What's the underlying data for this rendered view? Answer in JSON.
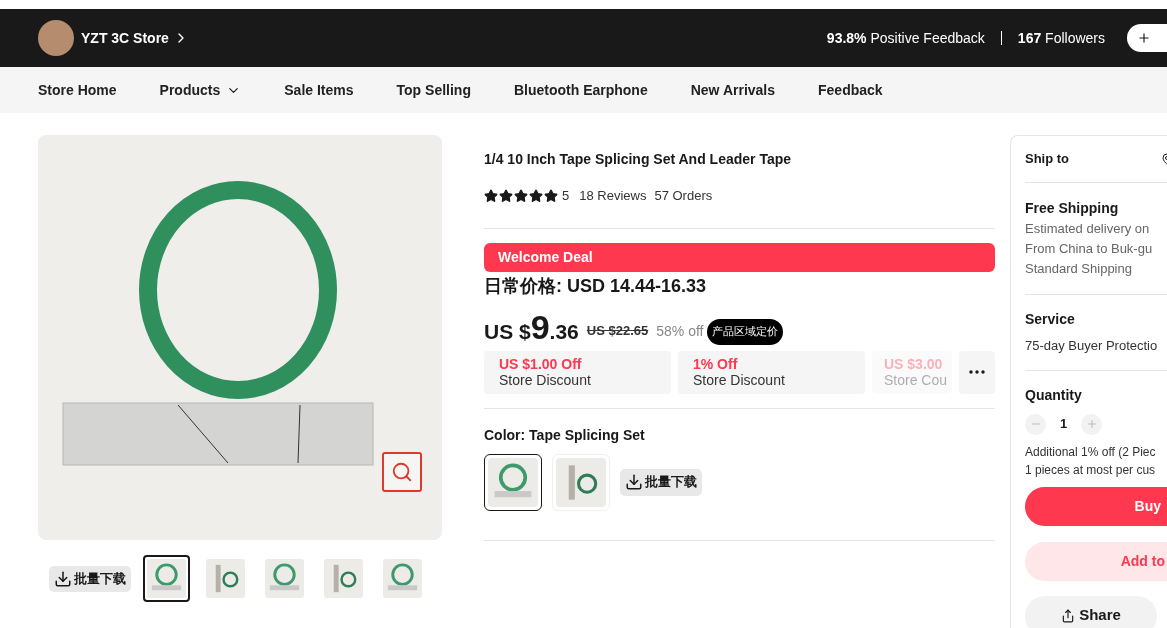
{
  "store_bar": {
    "name": "YZT 3C Store",
    "feedback_value": "93.8%",
    "feedback_label": "Positive Feedback",
    "followers_value": "167",
    "followers_label": "Followers"
  },
  "nav": [
    {
      "label": "Store Home",
      "dropdown": false
    },
    {
      "label": "Products",
      "dropdown": true
    },
    {
      "label": "Sale Items",
      "dropdown": false
    },
    {
      "label": "Top Selling",
      "dropdown": false
    },
    {
      "label": "Bluetooth Earphone",
      "dropdown": false
    },
    {
      "label": "New Arrivals",
      "dropdown": false
    },
    {
      "label": "Feedback",
      "dropdown": false
    }
  ],
  "gallery": {
    "download_label": "批量下载",
    "thumbnails": [
      {
        "selected": true
      },
      {
        "selected": false
      },
      {
        "selected": false
      },
      {
        "selected": false
      },
      {
        "selected": false
      }
    ]
  },
  "product": {
    "title": "1/4 10 Inch Tape Splicing Set And Leader Tape",
    "stars": 5,
    "rating": "5",
    "reviews": "18 Reviews",
    "orders": "57 Orders",
    "deal_banner": "Welcome Deal",
    "regular_price": "日常价格: USD 14.44-16.33",
    "price": {
      "currency": "US $",
      "whole": "9",
      "fraction": ".36",
      "original": "US $22.65",
      "discount": "58% off",
      "badge": "产品区域定价"
    },
    "coupons": [
      {
        "amount": "US $1.00 Off",
        "label": "Store Discount",
        "faded": false
      },
      {
        "amount": "1% Off",
        "label": "Store Discount",
        "faded": false
      },
      {
        "amount": "US $3.00",
        "label": "Store Cou",
        "faded": true
      }
    ],
    "color_label": "Color: Tape Splicing Set",
    "color_options": [
      {
        "selected": true
      },
      {
        "selected": false
      }
    ],
    "download_label": "批量下载"
  },
  "side": {
    "ship_to": "Ship to",
    "shipping_title": "Free Shipping",
    "shipping_lines": [
      "Estimated delivery on",
      "From China to Buk-gu",
      "Standard Shipping"
    ],
    "service_title": "Service",
    "service_text": "75-day Buyer Protectio",
    "quantity_title": "Quantity",
    "quantity": "1",
    "quantity_notes": [
      "Additional 1% off (2 Piec",
      "1 pieces at most per cus"
    ],
    "buy": "Buy",
    "cart": "Add to",
    "share": "Share"
  }
}
